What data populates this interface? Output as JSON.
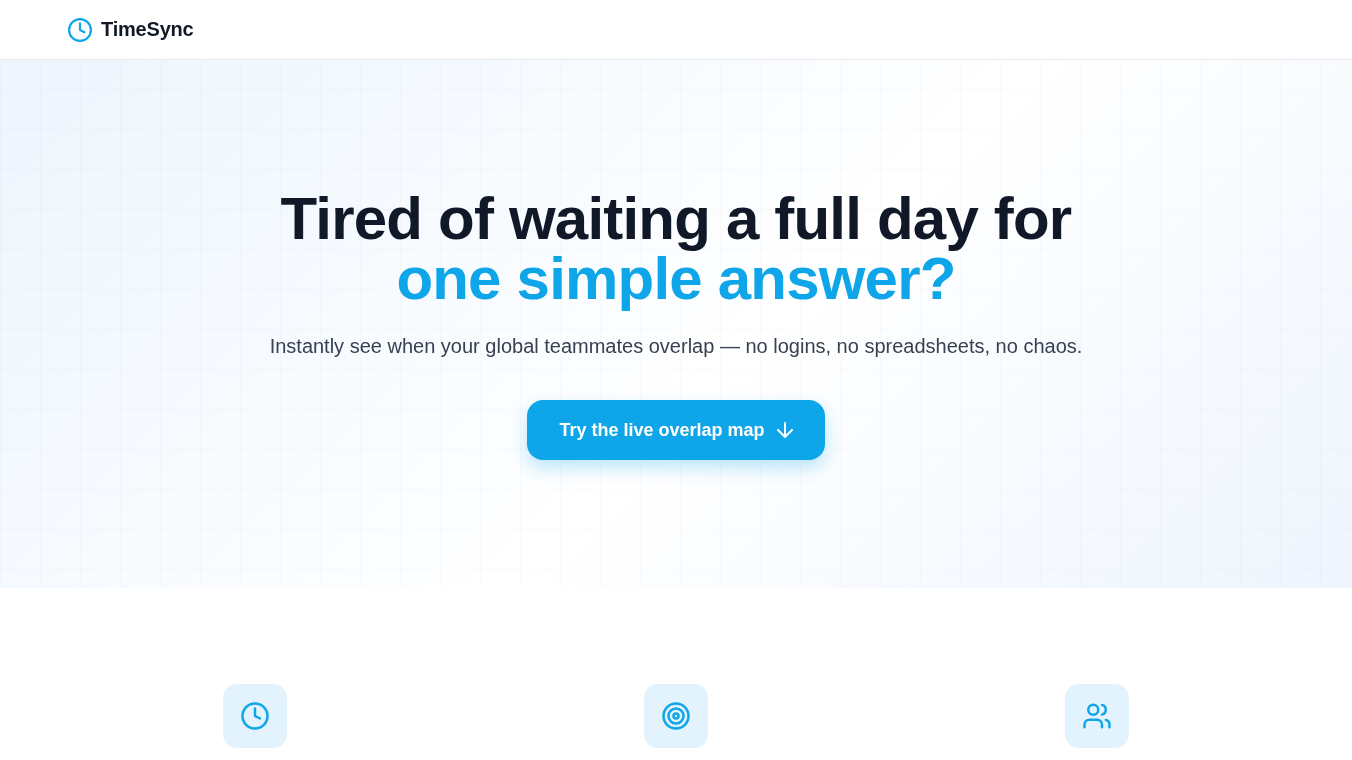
{
  "header": {
    "brand": "TimeSync"
  },
  "hero": {
    "title": "Tired of waiting a full day for",
    "title_highlight": "one simple answer?",
    "subtitle": "Instantly see when your global teammates overlap — no logins, no spreadsheets, no chaos.",
    "cta": {
      "label": "Try the live overlap map"
    }
  }
}
